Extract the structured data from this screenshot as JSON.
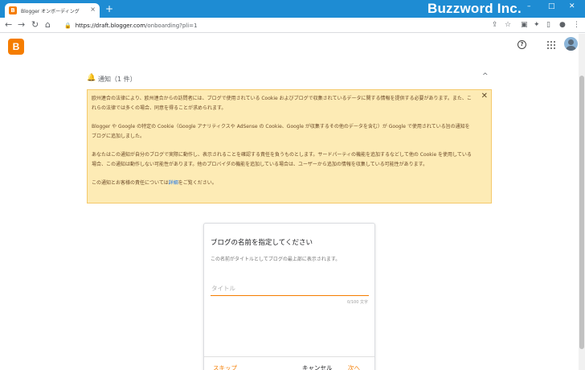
{
  "browser": {
    "tab_title": "Blogger オンボーディング",
    "favicon_letter": "B",
    "new_tab": "+",
    "tab_close": "×",
    "brand_watermark": "Buzzword Inc.",
    "window_controls": {
      "minimize": "–",
      "maximize": "□",
      "close": "✕"
    },
    "nav": {
      "back": "←",
      "forward": "→",
      "reload": "↻",
      "home": "⌂"
    },
    "url_host": "https://draft.blogger.com",
    "url_path": "/onboarding?pli=1",
    "lock": "🔒"
  },
  "header": {
    "logo_letter": "B",
    "help": "?"
  },
  "notification": {
    "bell": "🔔",
    "title": "通知（1 件）",
    "collapse": "^",
    "close": "✕",
    "paragraphs": [
      "欧州連合の法律により、欧州連合からの訪問者には、ブログで使用されている Cookie およびブログで収集されているデータに関する情報を提供する必要があります。また、これらの法律では多くの場合、同意を得ることが求められます。",
      "Blogger や Google の特定の Cookie（Google アナリティクスや AdSense の Cookie、Google が収集するその他のデータを含む）が Google で使用されている旨の通知をブログに追加しました。",
      "あなたはこの通知が自分のブログで実際に動作し、表示されることを確認する責任を負うものとします。サードパーティの機能を追加するなどして他の Cookie を使用している場合、この通知は動作しない可能性があります。他のプロバイダの機能を追加している場合は、ユーザーから追加の情報を収集している可能性があります。"
    ],
    "last_before": "この通知とお客様の責任については",
    "link": "詳細",
    "last_after": "をご覧ください。"
  },
  "dialog": {
    "title": "ブログの名前を指定してください",
    "description": "この名前がタイトルとしてブログの最上部に表示されます。",
    "input_placeholder": "タイトル",
    "input_value": "",
    "char_count": "0/100 文字",
    "skip": "スキップ",
    "cancel": "キャンセル",
    "next": "次へ"
  },
  "colors": {
    "titlebar": "#1e8cd3",
    "blogger_orange": "#f57d00",
    "notice_bg": "#fdebb5",
    "notice_border": "#f5c96b",
    "link": "#1a73e8"
  }
}
